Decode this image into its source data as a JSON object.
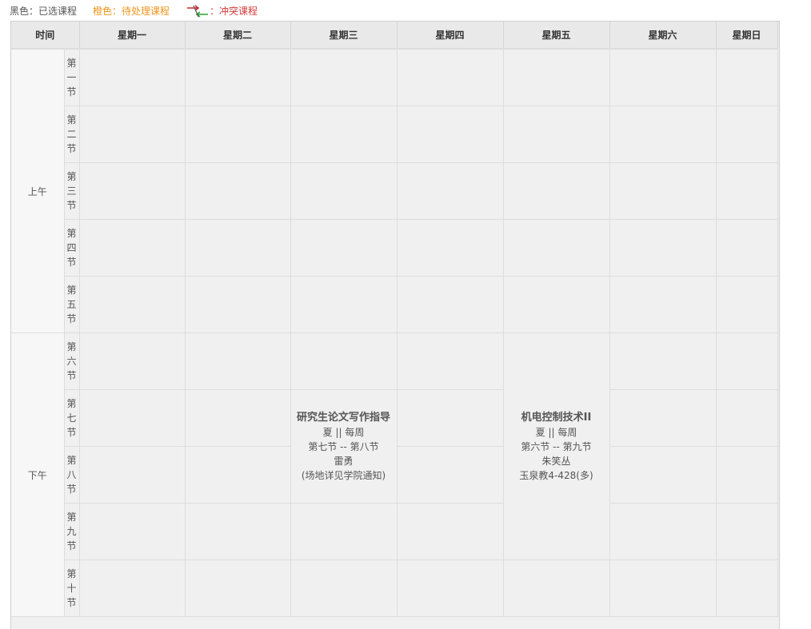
{
  "legend": {
    "black": "黑色：已选课程",
    "orange": "橙色：待处理课程",
    "conflict": "：冲突课程",
    "conflict_icon": "conflict-arrows-icon",
    "colors": {
      "selected": "#555555",
      "pending": "#f0941b",
      "conflict": "#d33a3a",
      "arrow_red": "#c8262c",
      "arrow_green": "#2a9d2a"
    }
  },
  "header": {
    "time": "时间",
    "days": [
      "星期一",
      "星期二",
      "星期三",
      "星期四",
      "星期五",
      "星期六",
      "星期日"
    ]
  },
  "periods": {
    "morning": "上午",
    "afternoon": "下午"
  },
  "sections": [
    [
      "第",
      "一",
      "节"
    ],
    [
      "第",
      "二",
      "节"
    ],
    [
      "第",
      "三",
      "节"
    ],
    [
      "第",
      "四",
      "节"
    ],
    [
      "第",
      "五",
      "节"
    ],
    [
      "第",
      "六",
      "节"
    ],
    [
      "第",
      "七",
      "节"
    ],
    [
      "第",
      "八",
      "节"
    ],
    [
      "第",
      "九",
      "节"
    ],
    [
      "第",
      "十",
      "节"
    ]
  ],
  "courses": {
    "wed": {
      "name": "研究生论文写作指导",
      "term": "夏 ||  每周",
      "time": "第七节 -- 第八节",
      "teacher": "雷勇",
      "location": "(场地详见学院通知)"
    },
    "fri": {
      "name": "机电控制技术II",
      "term": "夏 ||  每周",
      "time": "第六节 -- 第九节",
      "teacher": "朱笑丛",
      "location": "玉泉教4-428(多)"
    }
  }
}
